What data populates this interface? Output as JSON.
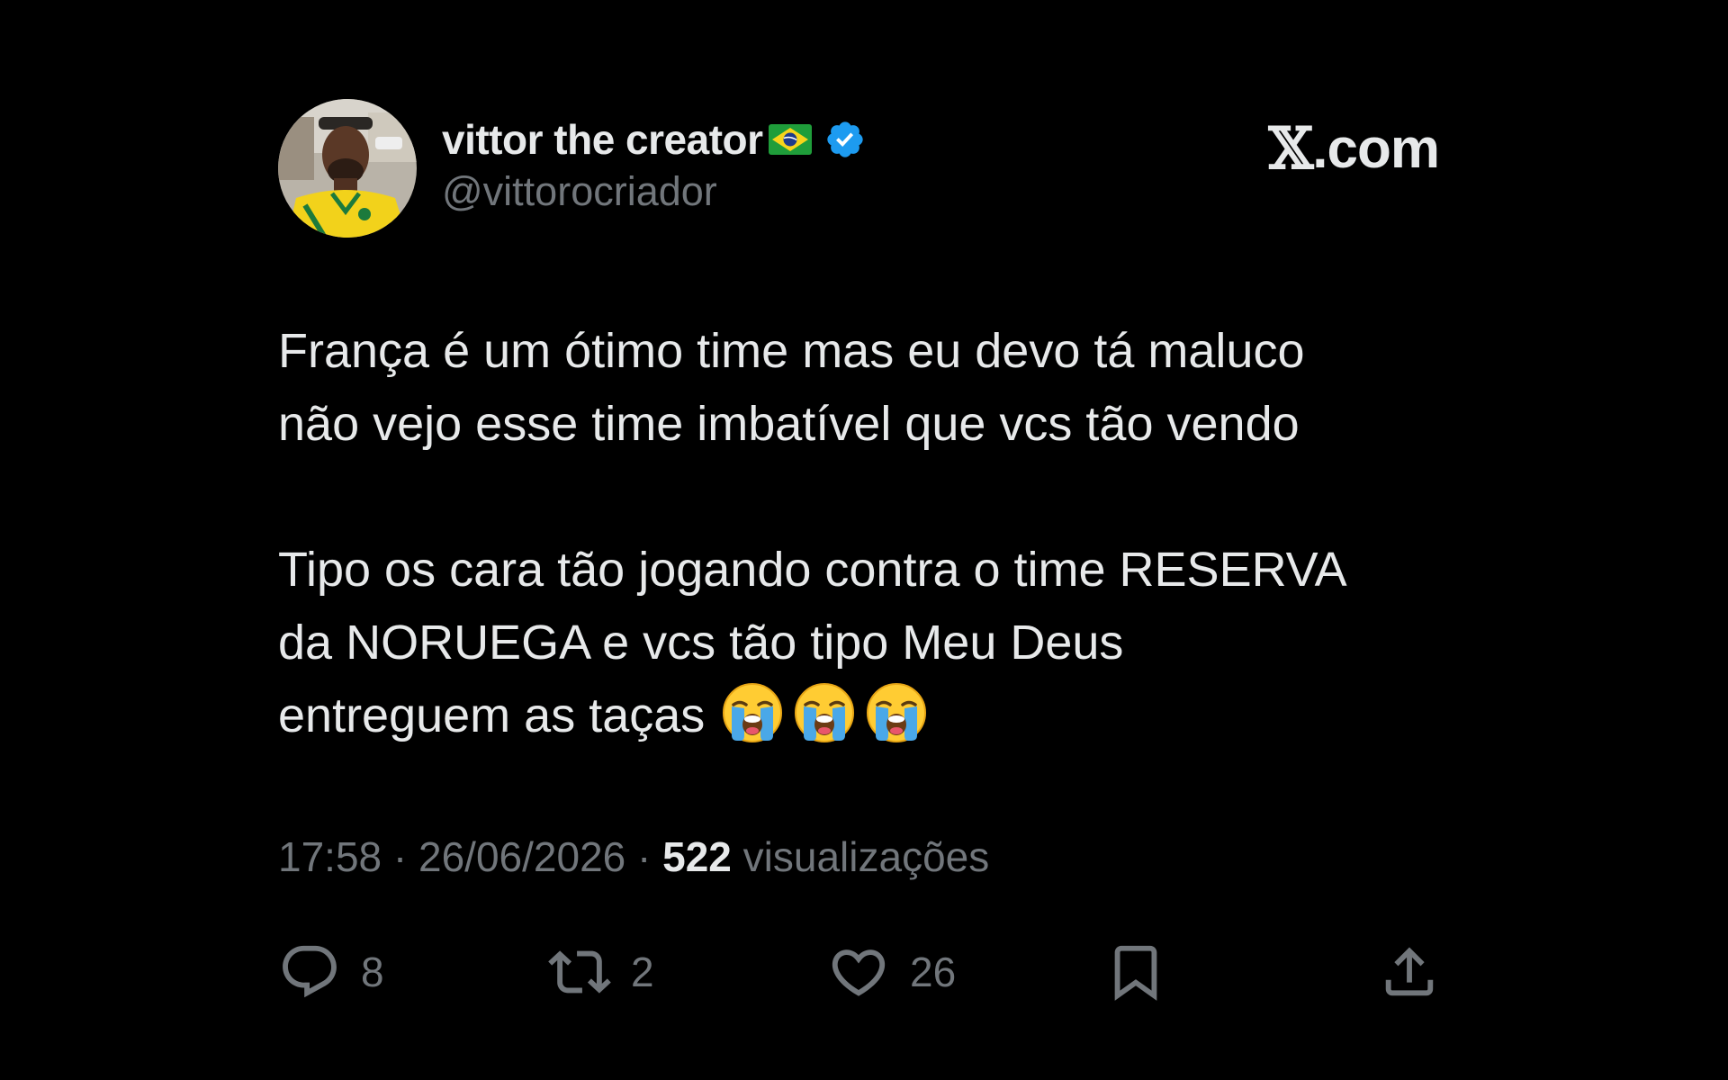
{
  "tweet": {
    "display_name": "vittor the creator",
    "handle": "@vittorocriador",
    "brand": "X.com",
    "brand_x": "𝕏",
    "brand_suffix": ".com",
    "body": {
      "paragraph_1": {
        "line_1": "França é um ótimo time mas eu devo tá maluco",
        "line_2": "não vejo esse time imbatível que vcs tão vendo"
      },
      "paragraph_2": {
        "line_1": "Tipo os cara tão jogando contra o time RESERVA",
        "line_2": "da NORUEGA e vcs tão tipo Meu Deus",
        "line_3": "entreguem as taças"
      },
      "emojis": [
        "loudly-crying-face-icon",
        "loudly-crying-face-icon",
        "loudly-crying-face-icon"
      ]
    },
    "meta": {
      "time": "17:58",
      "separator": " · ",
      "date": "26/06/2026",
      "views_count": "522",
      "views_label": "visualizações"
    },
    "actions": {
      "replies": "8",
      "retweets": "2",
      "likes": "26"
    }
  },
  "colors": {
    "background": "#000000",
    "primary_text": "#e7e9ea",
    "secondary_text": "#71767b",
    "verified": "#1d9bf0"
  },
  "icons": {
    "flag": "brazil-flag-icon",
    "verified": "verified-badge-icon",
    "reply": "reply-icon",
    "retweet": "retweet-icon",
    "like": "heart-icon",
    "bookmark": "bookmark-icon",
    "share": "share-icon"
  }
}
